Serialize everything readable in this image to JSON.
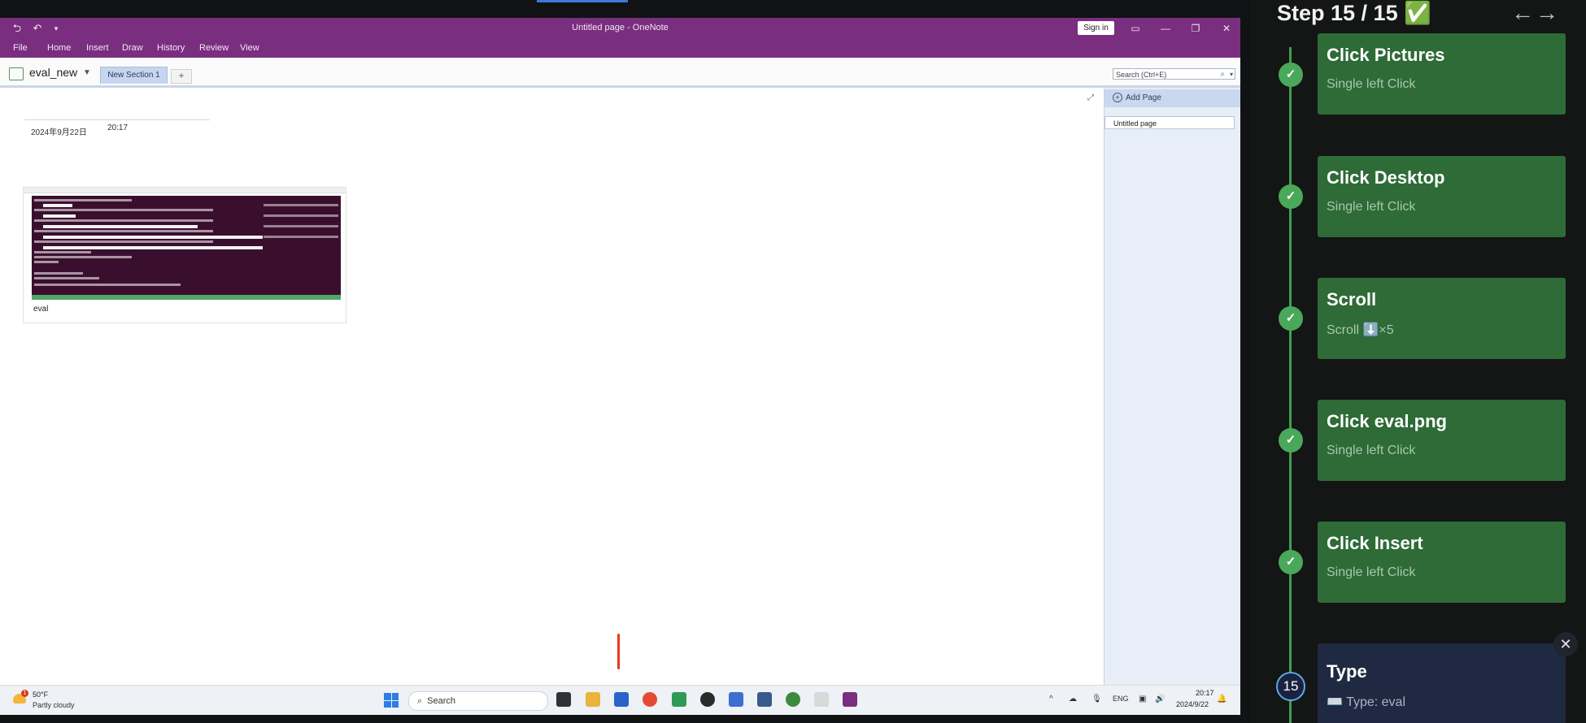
{
  "window": {
    "title": "Untitled page - OneNote",
    "sign_in": "Sign in"
  },
  "ribbon": {
    "tabs": [
      "File",
      "Home",
      "Insert",
      "Draw",
      "History",
      "Review",
      "View"
    ]
  },
  "notebook": {
    "name": "eval_new",
    "section_tab": "New Section 1",
    "add_section": "+"
  },
  "search": {
    "placeholder": "Search (Ctrl+E)"
  },
  "page": {
    "date": "2024年9月22日",
    "time": "20:17",
    "image_caption": "eval"
  },
  "pages_pane": {
    "add_page": "Add Page",
    "pages": [
      "Untitled page"
    ]
  },
  "taskbar": {
    "weather_temp": "50°F",
    "weather_desc": "Partly cloudy",
    "weather_badge": "1",
    "search_label": "Search",
    "language": "ENG",
    "clock_time": "20:17",
    "clock_date": "2024/9/22"
  },
  "panel": {
    "header": "Step 15 / 15 ✅",
    "nav": "←→",
    "steps": [
      {
        "title": "Click Pictures",
        "subtitle": "Single left Click",
        "marker": "✓"
      },
      {
        "title": "Click Desktop",
        "subtitle": "Single left Click",
        "marker": "✓"
      },
      {
        "title": "Scroll",
        "subtitle": "Scroll ⬇️×5",
        "marker": "✓"
      },
      {
        "title": "Click eval.png",
        "subtitle": "Single left Click",
        "marker": "✓"
      },
      {
        "title": "Click Insert",
        "subtitle": "Single left Click",
        "marker": "✓"
      }
    ],
    "current": {
      "number": "15",
      "title": "Type",
      "subtitle": "⌨️ Type: eval"
    },
    "close": "✕"
  },
  "colors": {
    "onenote_purple": "#7a2e7f",
    "step_green": "#2e6b37",
    "timeline_green": "#3fa04f",
    "current_card": "#1f2a42"
  }
}
